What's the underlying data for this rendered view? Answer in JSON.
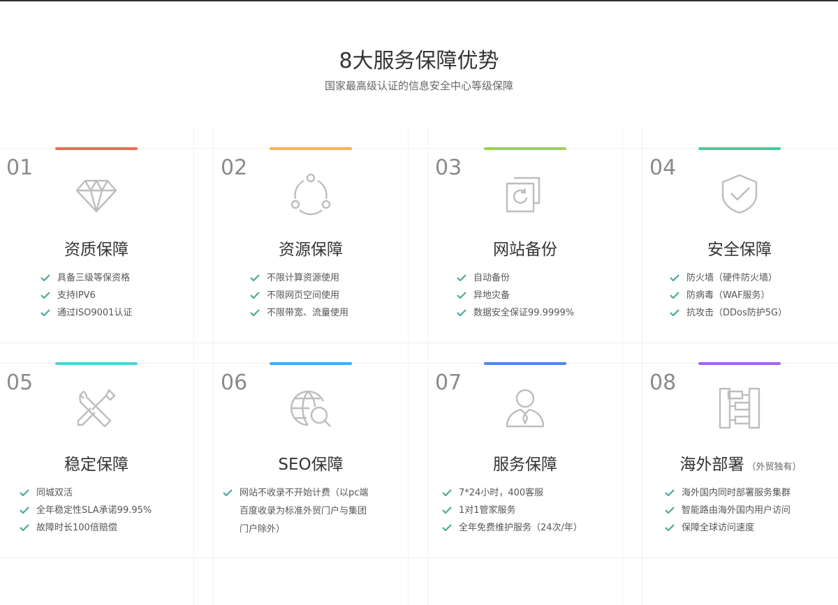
{
  "header": {
    "title": "8大服务保障优势",
    "subtitle": "国家最高级认证的信息安全中心等级保障"
  },
  "colors": {
    "check": "#4aa99b",
    "icon": "#bdbdbd",
    "bars": [
      "#f06a4f",
      "#f7b73b",
      "#9bd24f",
      "#43cf93",
      "#44d8d8",
      "#45abee",
      "#4c86ee",
      "#a463ee"
    ]
  },
  "cards": [
    {
      "num": "01",
      "icon": "diamond-icon",
      "title": "资质保障",
      "items": [
        "具备三级等保资格",
        "支持IPV6",
        "通过ISO9001认证"
      ]
    },
    {
      "num": "02",
      "icon": "resource-cycle-icon",
      "title": "资源保障",
      "items": [
        "不限计算资源使用",
        "不限网页空间使用",
        "不限带宽、流量使用"
      ]
    },
    {
      "num": "03",
      "icon": "backup-copy-icon",
      "title": "网站备份",
      "items": [
        "自动备份",
        "异地灾备",
        "数据安全保证99.9999%"
      ]
    },
    {
      "num": "04",
      "icon": "shield-check-icon",
      "title": "安全保障",
      "items": [
        "防火墙（硬件防火墙）",
        "防病毒（WAF服务）",
        "抗攻击（DDos防护5G）"
      ]
    },
    {
      "num": "05",
      "icon": "wrench-screwdriver-icon",
      "title": "稳定保障",
      "items": [
        "同城双活",
        "全年稳定性SLA承诺99.95%",
        "故障时长100倍赔偿"
      ]
    },
    {
      "num": "06",
      "icon": "globe-search-icon",
      "title": "SEO保障",
      "items": [
        "网站不收录不开始计费（以pc端百度收录为标准外贸门户与集团门户除外）"
      ]
    },
    {
      "num": "07",
      "icon": "user-service-icon",
      "title": "服务保障",
      "items": [
        "7*24小时，400客服",
        "1对1管家服务",
        "全年免费维护服务（24次/年）"
      ]
    },
    {
      "num": "08",
      "icon": "sitemap-icon",
      "title": "海外部署",
      "title_tag": "（外贸独有）",
      "items": [
        "海外国内同时部署服务集群",
        "智能路由海外国内用户访问",
        "保障全球访问速度"
      ]
    }
  ]
}
